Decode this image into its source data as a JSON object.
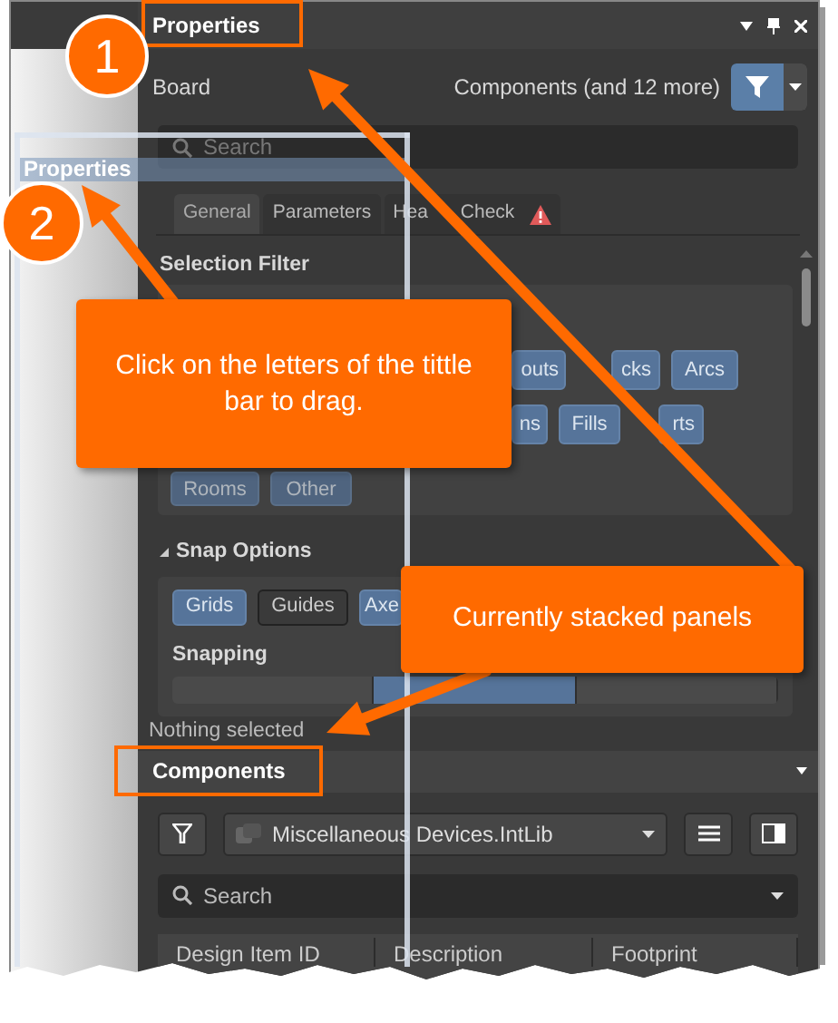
{
  "properties_panel": {
    "title": "Properties",
    "header_left": "Board",
    "header_right": "Components (and 12 more)",
    "search": {
      "placeholder": "Search"
    },
    "tabs": [
      {
        "parts": [
          "General"
        ],
        "selected": true
      },
      {
        "parts": [
          "Parameters"
        ],
        "selected": false
      },
      {
        "parts": [
          "Hea",
          "Check"
        ],
        "selected": false
      }
    ],
    "selection_filter": {
      "title": "Selection Filter",
      "buttons": [
        {
          "label": "outs",
          "on": true
        },
        {
          "label": "cks",
          "on": true
        },
        {
          "label": "Arcs",
          "on": true
        },
        {
          "label": "ns",
          "on": true
        },
        {
          "label": "Fills",
          "on": true
        },
        {
          "label": "rts",
          "on": true
        },
        {
          "label": "Rooms",
          "on": true
        },
        {
          "label": "Other",
          "on": true
        }
      ]
    },
    "snap_options": {
      "title": "Snap Options",
      "expanded": true,
      "buttons": [
        {
          "label": "Grids",
          "on": true
        },
        {
          "label": "Guides",
          "on": false
        },
        {
          "label": "Axe",
          "on": true
        }
      ]
    },
    "snapping": {
      "title": "Snapping",
      "segments": [
        {
          "selected": false
        },
        {
          "selected": true
        },
        {
          "selected": false
        }
      ]
    },
    "status": "Nothing selected"
  },
  "components_panel": {
    "title": "Components",
    "library": "Miscellaneous Devices.IntLib",
    "search": {
      "placeholder": "Search"
    },
    "columns": [
      "Design Item ID",
      "Description",
      "Footprint"
    ]
  },
  "floating_panel": {
    "title": "Properties"
  },
  "annotations": {
    "markers": [
      "1",
      "2"
    ],
    "callouts": [
      "Click on the letters of the tittle bar to drag.",
      "Currently stacked panels"
    ]
  }
}
